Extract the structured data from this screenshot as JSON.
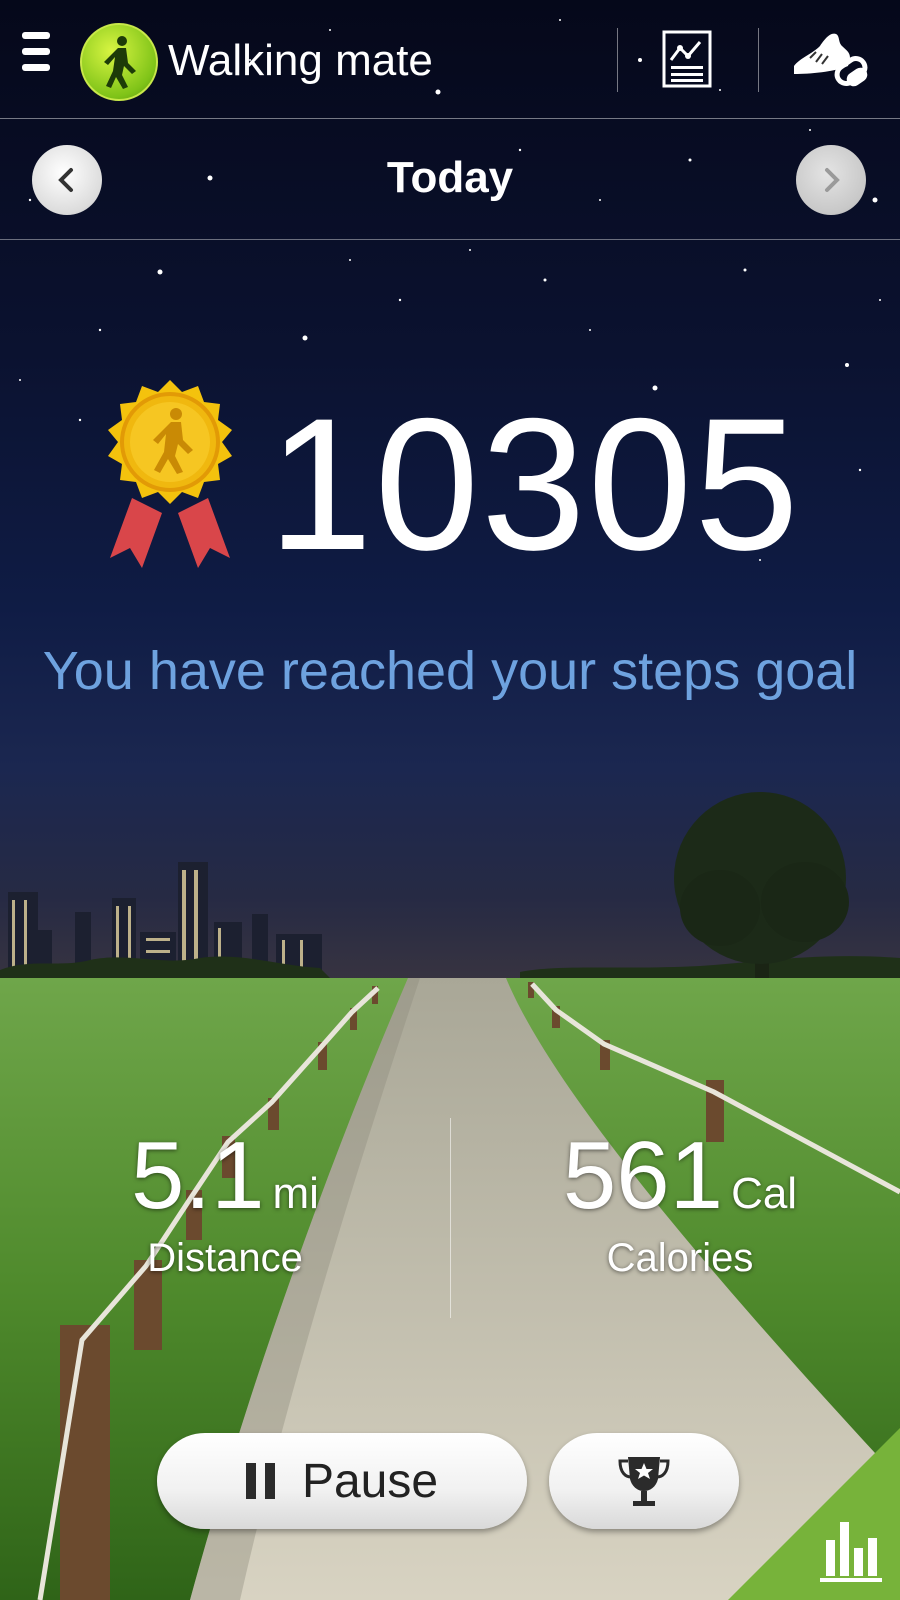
{
  "header": {
    "app_title": "Walking mate",
    "menu_icon": "menu-icon",
    "logo_icon": "walker-logo-icon",
    "report_icon": "chart-report-icon",
    "shoe_icon": "shoe-link-icon"
  },
  "date_nav": {
    "title": "Today",
    "prev_icon": "chevron-left-icon",
    "next_icon": "chevron-right-icon"
  },
  "steps": {
    "count": "10305",
    "goal_message": "You have reached your steps goal",
    "medal_icon": "medal-icon"
  },
  "stats": {
    "distance_value": "5.1",
    "distance_unit": "mi",
    "distance_label": "Distance",
    "calories_value": "561",
    "calories_unit": "Cal",
    "calories_label": "Calories"
  },
  "controls": {
    "pause_label": "Pause",
    "trophy_icon": "trophy-icon",
    "stats_icon": "bar-chart-icon"
  },
  "colors": {
    "goal_text": "#6ea2df",
    "accent_green": "#77b33a"
  }
}
